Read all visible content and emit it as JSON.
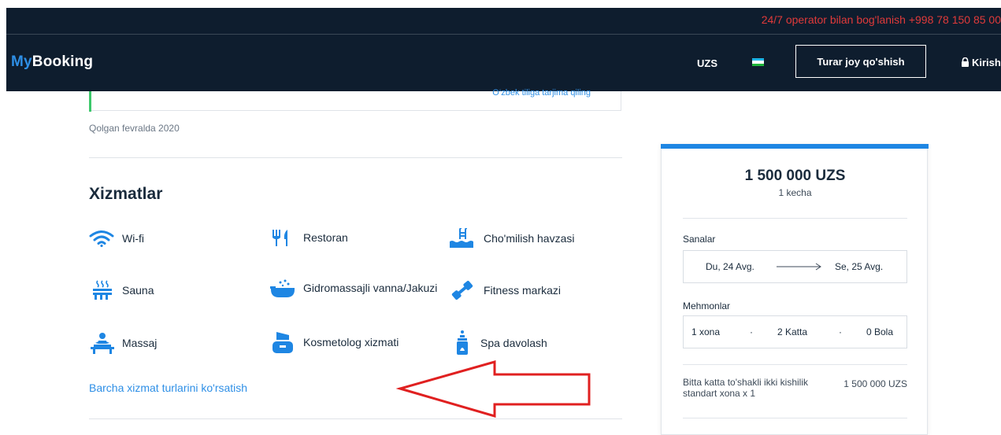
{
  "topbar": {
    "contact": "24/7 operator bilan bog'lanish +998 78 150 85 00"
  },
  "header": {
    "logo_my": "My",
    "logo_booking": "Booking",
    "currency": "UZS",
    "add_property": "Turar joy qo'shish",
    "login": "Kirish"
  },
  "review": {
    "translate_link": "O‘zbek tiliga tarjima qiling",
    "stay_date": "Qolgan fevralda 2020"
  },
  "services": {
    "title": "Xizmatlar",
    "items": [
      {
        "label": "Wi-fi",
        "icon": "wifi-icon"
      },
      {
        "label": "Restoran",
        "icon": "restaurant-icon"
      },
      {
        "label": "Cho'milish havzasi",
        "icon": "pool-icon"
      },
      {
        "label": "Sauna",
        "icon": "sauna-icon"
      },
      {
        "label": "Gidromassajli vanna/Jakuzi",
        "icon": "jacuzzi-icon"
      },
      {
        "label": "Fitness markazi",
        "icon": "dumbbell-icon"
      },
      {
        "label": "Massaj",
        "icon": "massage-icon"
      },
      {
        "label": "Kosmetolog xizmati",
        "icon": "cosmetics-icon"
      },
      {
        "label": "Spa davolash",
        "icon": "spa-icon"
      }
    ],
    "show_all": "Barcha xizmat turlarini ko'rsatish"
  },
  "booking": {
    "price": "1 500 000 UZS",
    "per_night": "1 kecha",
    "dates_label": "Sanalar",
    "check_in": "Du, 24 Avg.",
    "check_out": "Se, 25 Avg.",
    "guests_label": "Mehmonlar",
    "rooms": "1 xona",
    "adults": "2 Katta",
    "children": "0 Bola",
    "summary_room": "Bitta katta to'shakli ikki kishilik standart xona x 1",
    "summary_price": "1 500 000 UZS"
  },
  "colors": {
    "header_bg": "#0e1d2e",
    "accent_blue": "#2e8fe6",
    "phone_red": "#e03a3a",
    "annotation_arrow": "#e02020"
  }
}
